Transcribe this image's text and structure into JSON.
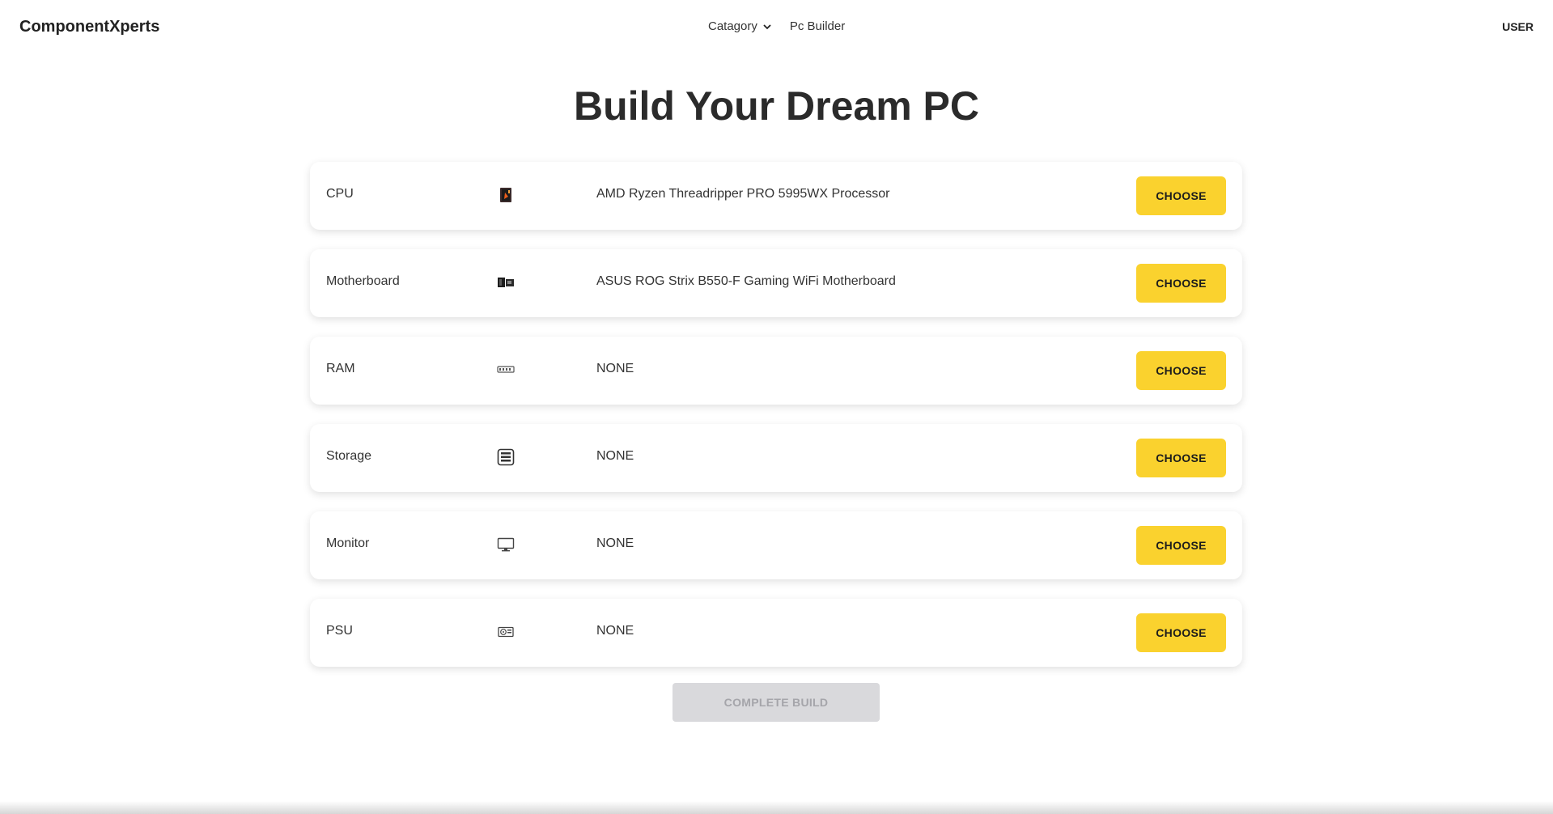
{
  "brand": "ComponentXperts",
  "nav": {
    "category_label": "Catagory",
    "pc_builder_label": "Pc Builder",
    "user_label": "USER"
  },
  "page_title": "Build Your Dream PC",
  "rows": [
    {
      "label": "CPU",
      "icon": "cpu-icon",
      "value": "AMD Ryzen Threadripper PRO 5995WX Processor",
      "button": "CHOOSE"
    },
    {
      "label": "Motherboard",
      "icon": "motherboard-icon",
      "value": "ASUS ROG Strix B550-F Gaming WiFi Motherboard",
      "button": "CHOOSE"
    },
    {
      "label": "RAM",
      "icon": "ram-icon",
      "value": "NONE",
      "button": "CHOOSE"
    },
    {
      "label": "Storage",
      "icon": "storage-icon",
      "value": "NONE",
      "button": "CHOOSE"
    },
    {
      "label": "Monitor",
      "icon": "monitor-icon",
      "value": "NONE",
      "button": "CHOOSE"
    },
    {
      "label": "PSU",
      "icon": "psu-icon",
      "value": "NONE",
      "button": "CHOOSE"
    }
  ],
  "complete_button": "COMPLETE BUILD",
  "colors": {
    "accent": "#fad22e",
    "disabled_bg": "#d9d9dc",
    "disabled_text": "#a5a5aa"
  }
}
